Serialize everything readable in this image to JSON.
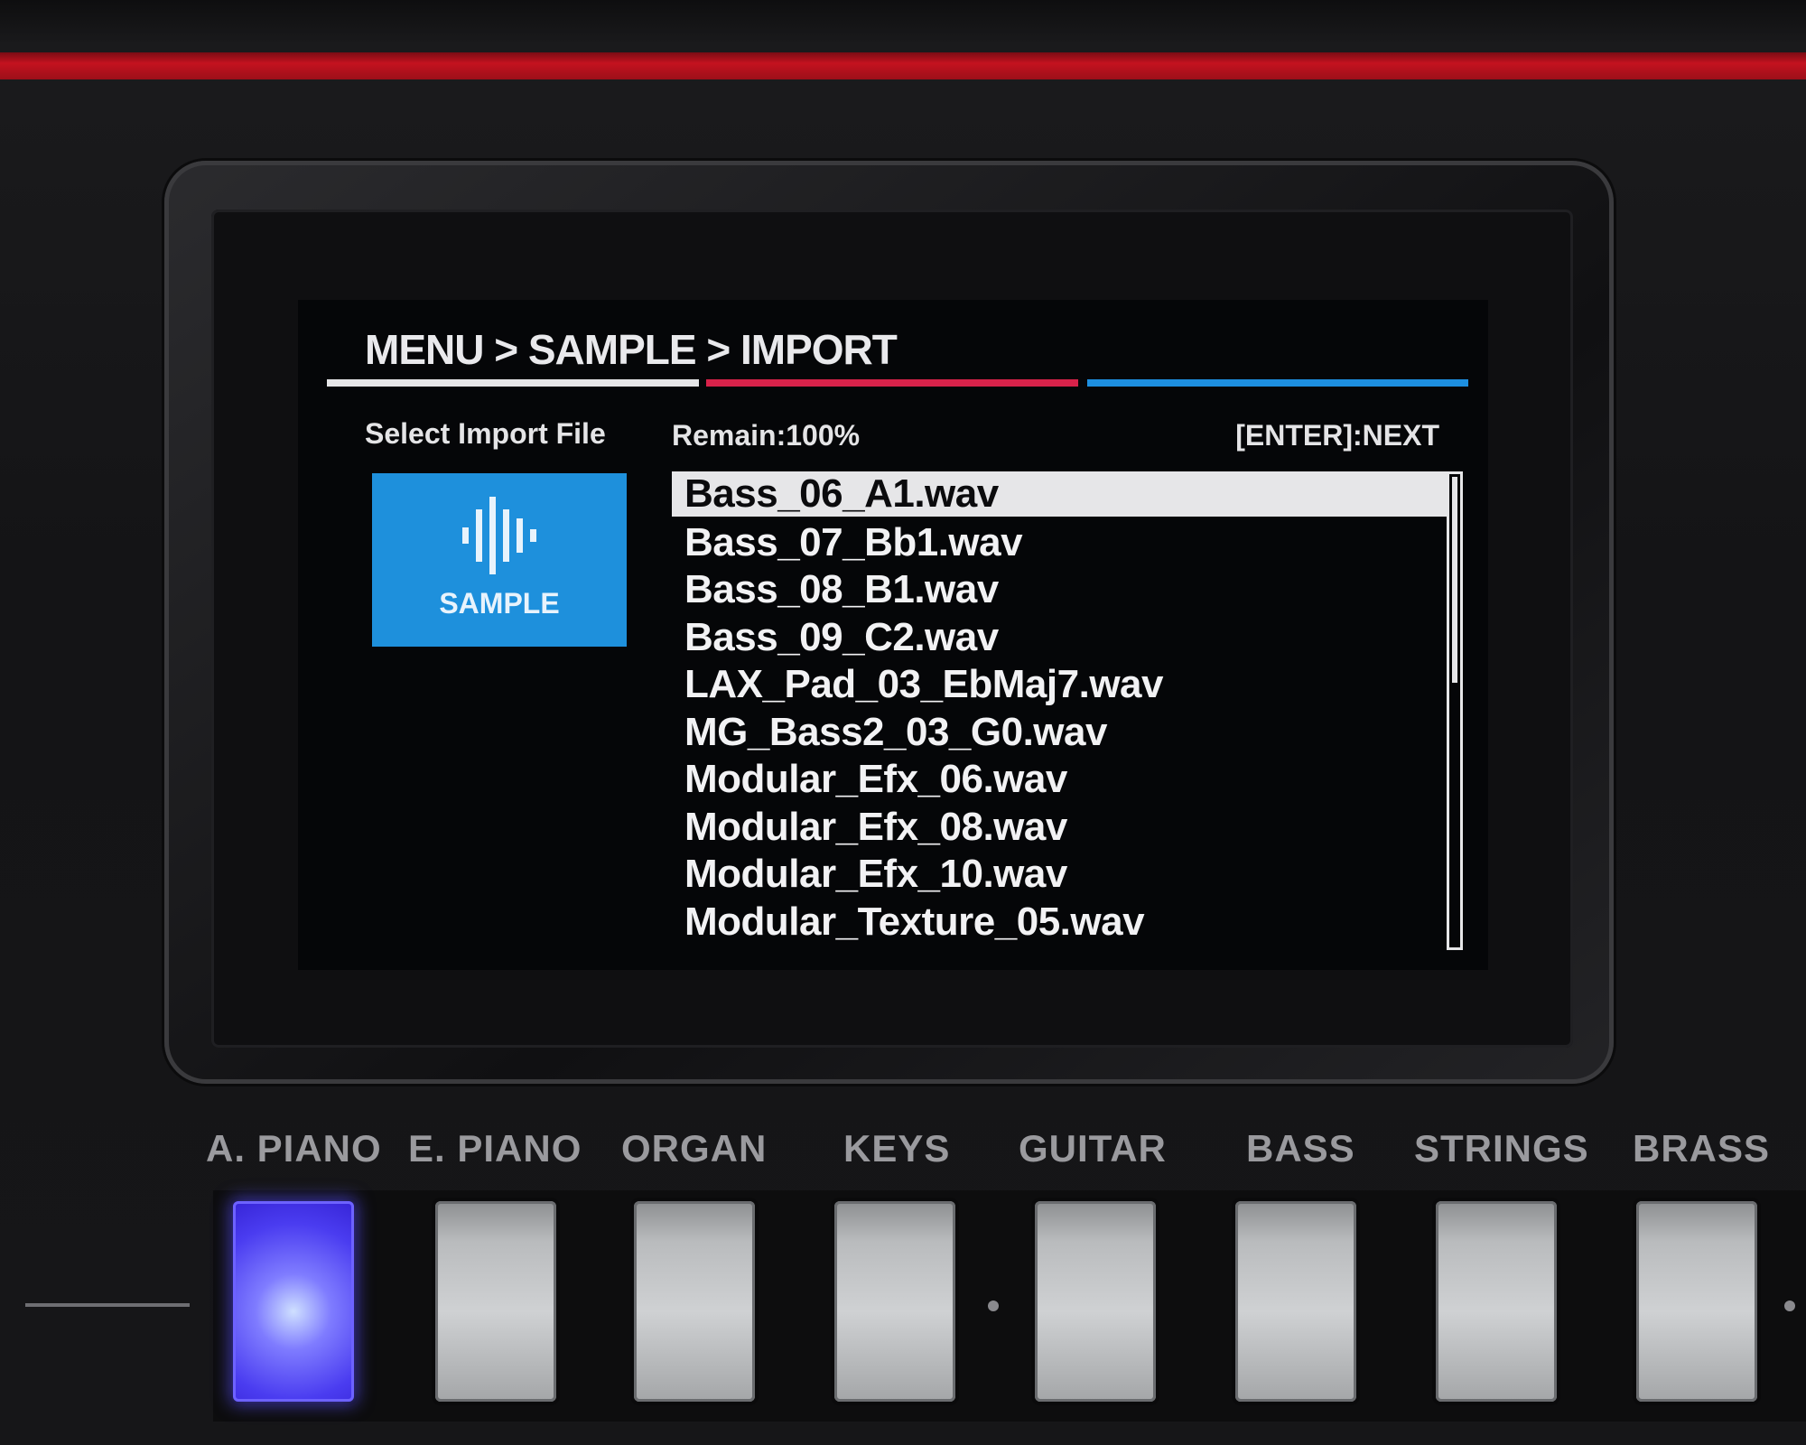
{
  "screen": {
    "breadcrumb": "MENU > SAMPLE > IMPORT",
    "select_label": "Select Import File",
    "remain": "Remain:100%",
    "enter_hint": "[ENTER]:NEXT",
    "tile_label": "SAMPLE",
    "tile_icon": "waveform-icon",
    "files": [
      "Bass_06_A1.wav",
      "Bass_07_Bb1.wav",
      "Bass_08_B1.wav",
      "Bass_09_C2.wav",
      "LAX_Pad_03_EbMaj7.wav",
      "MG_Bass2_03_G0.wav",
      "Modular_Efx_06.wav",
      "Modular_Efx_08.wav",
      "Modular_Efx_10.wav",
      "Modular_Texture_05.wav"
    ],
    "selected_index": 0,
    "colors": {
      "accent_blue": "#1e90dc",
      "accent_red": "#d8224a",
      "brand_red": "#c4121f"
    }
  },
  "categories": [
    {
      "label": "A. PIANO",
      "active": true
    },
    {
      "label": "E. PIANO",
      "active": false
    },
    {
      "label": "ORGAN",
      "active": false
    },
    {
      "label": "KEYS",
      "active": false
    },
    {
      "label": "GUITAR",
      "active": false
    },
    {
      "label": "BASS",
      "active": false
    },
    {
      "label": "STRINGS",
      "active": false
    },
    {
      "label": "BRASS",
      "active": false
    }
  ]
}
